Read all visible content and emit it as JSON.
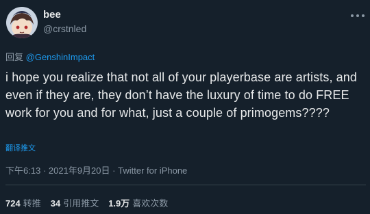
{
  "author": {
    "name": "bee",
    "handle": "@crstnled"
  },
  "reply": {
    "prefix": "回复",
    "mention": "@GenshinImpact"
  },
  "tweet": {
    "text": "i hope you realize that not all of your playerbase are artists, and even if they are, they don’t have the luxury of time to do FREE work for you and for what, just a couple of primogems????",
    "translate_label": "翻译推文"
  },
  "meta": {
    "time": "下午6:13",
    "sep": "·",
    "date": "2021年9月20日",
    "client": "Twitter for iPhone"
  },
  "stats": {
    "retweets": {
      "count": "724",
      "label": "转推"
    },
    "quotes": {
      "count": "34",
      "label": "引用推文"
    },
    "likes": {
      "count": "1.9万",
      "label": "喜欢次数"
    }
  },
  "icons": {
    "more": "more-horizontal-icon",
    "avatar": "avatar-illustration"
  },
  "colors": {
    "background": "#15202b",
    "accent": "#1d9bf0",
    "text": "#e7e9ea",
    "secondary": "#8b98a5",
    "divider": "#38444d"
  }
}
